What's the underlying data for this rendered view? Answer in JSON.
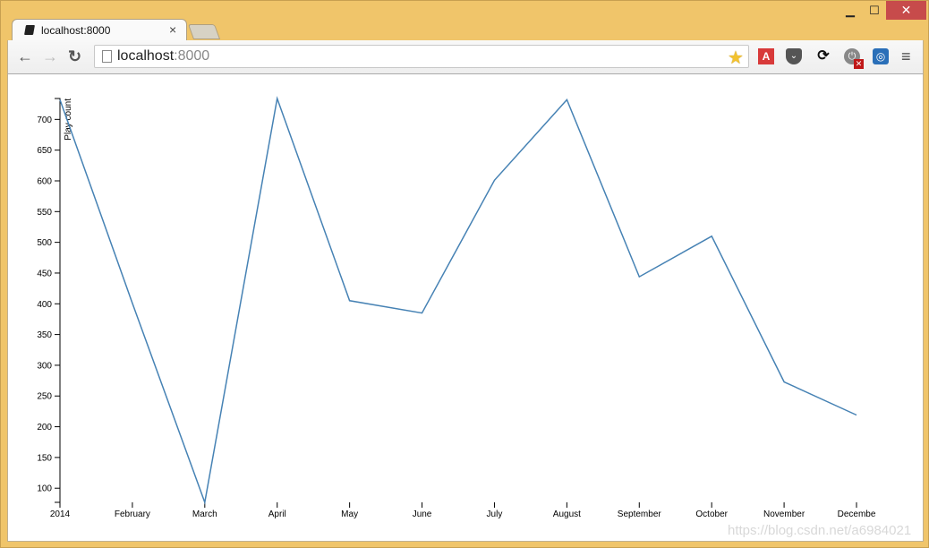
{
  "window": {
    "minimize_glyph": "▁",
    "maximize_glyph": "☐",
    "close_glyph": "✕"
  },
  "tab": {
    "title": "localhost:8000",
    "close_glyph": "×"
  },
  "toolbar": {
    "back_glyph": "←",
    "forward_glyph": "→",
    "reload_glyph": "↻",
    "url_host": "localhost",
    "url_port": ":8000",
    "star_glyph": "★",
    "extensions": [
      {
        "name": "acrobat-extension",
        "glyph": "A"
      },
      {
        "name": "pocket-extension",
        "glyph": "⌄"
      },
      {
        "name": "sync-extension",
        "glyph": "⟳"
      },
      {
        "name": "power-extension",
        "glyph": "⏻"
      },
      {
        "name": "blue-extension",
        "glyph": "◎"
      }
    ],
    "power_badge_glyph": "✕",
    "menu_glyph": "≡"
  },
  "watermark": "https://blog.csdn.net/a6984021",
  "chart_data": {
    "type": "line",
    "title": "",
    "xlabel": "",
    "ylabel": "Play count",
    "categories": [
      "2014",
      "February",
      "March",
      "April",
      "May",
      "June",
      "July",
      "August",
      "September",
      "October",
      "November",
      "Decembe"
    ],
    "series": [
      {
        "name": "Play count",
        "color": "#4682b4",
        "values": [
          732,
          401,
          77,
          734,
          405,
          385,
          601,
          732,
          444,
          510,
          273,
          219
        ]
      }
    ],
    "ylim": [
      77,
      734
    ],
    "yticks": [
      100,
      150,
      200,
      250,
      300,
      350,
      400,
      450,
      500,
      550,
      600,
      650,
      700
    ],
    "grid": false,
    "legend": "none"
  }
}
